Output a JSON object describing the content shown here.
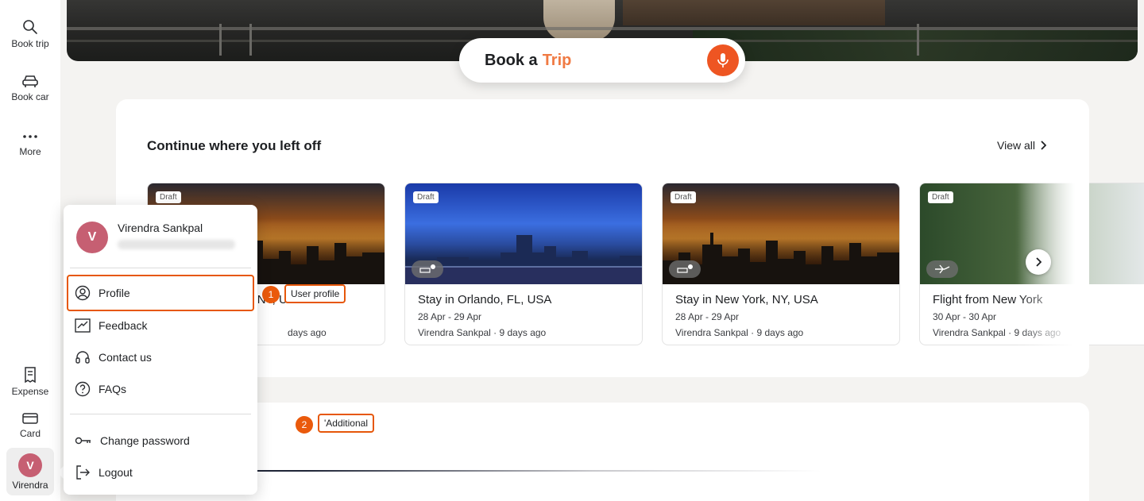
{
  "rail": {
    "items": [
      {
        "label": "Book trip",
        "icon": "search-icon"
      },
      {
        "label": "Book car",
        "icon": "car-icon"
      },
      {
        "label": "More",
        "icon": "more-icon"
      }
    ],
    "bottom_items": [
      {
        "label": "Expense",
        "icon": "receipt-icon"
      },
      {
        "label": "Card",
        "icon": "card-icon"
      }
    ],
    "user": {
      "initial": "V",
      "label": "Virendra"
    }
  },
  "hero": {
    "search": {
      "prefix": "Book a",
      "accent": "Trip"
    }
  },
  "continue": {
    "title": "Continue where you left off",
    "view_all": "View all",
    "trips": [
      {
        "badge": "Draft",
        "title": "Stay in New York, NY, USA",
        "dates": "",
        "meta": "days ago",
        "kind": "hotel-icon",
        "count": "1"
      },
      {
        "badge": "Draft",
        "title": "Stay in Orlando, FL, USA",
        "dates": "28 Apr - 29 Apr",
        "meta": "Virendra Sankpal · 9 days ago",
        "kind": "hotel-icon",
        "count": "1"
      },
      {
        "badge": "Draft",
        "title": "Stay in New York, NY, USA",
        "dates": "28 Apr - 29 Apr",
        "meta": "Virendra Sankpal · 9 days ago",
        "kind": "hotel-icon",
        "count": "1"
      },
      {
        "badge": "Draft",
        "title": "Flight from New York",
        "dates": "30 Apr - 30 Apr",
        "meta": "Virendra Sankpal · 9 days ago",
        "kind": "flight-icon",
        "count": "1"
      }
    ]
  },
  "annotations": [
    {
      "number": "1",
      "label": "User profile"
    },
    {
      "number": "2",
      "label": "'Additional"
    }
  ],
  "menu": {
    "avatar_initial": "V",
    "name": "Virendra Sankpal",
    "items": [
      {
        "label": "Profile",
        "icon": "user-circle-icon"
      },
      {
        "label": "Feedback",
        "icon": "feedback-icon"
      },
      {
        "label": "Contact us",
        "icon": "headset-icon"
      },
      {
        "label": "FAQs",
        "icon": "question-icon"
      },
      {
        "label": "Change password",
        "icon": "key-icon"
      },
      {
        "label": "Logout",
        "icon": "logout-icon"
      }
    ]
  },
  "colors": {
    "accent": "#ee5522",
    "avatar": "#c65f72",
    "highlight": "#e6570a"
  }
}
